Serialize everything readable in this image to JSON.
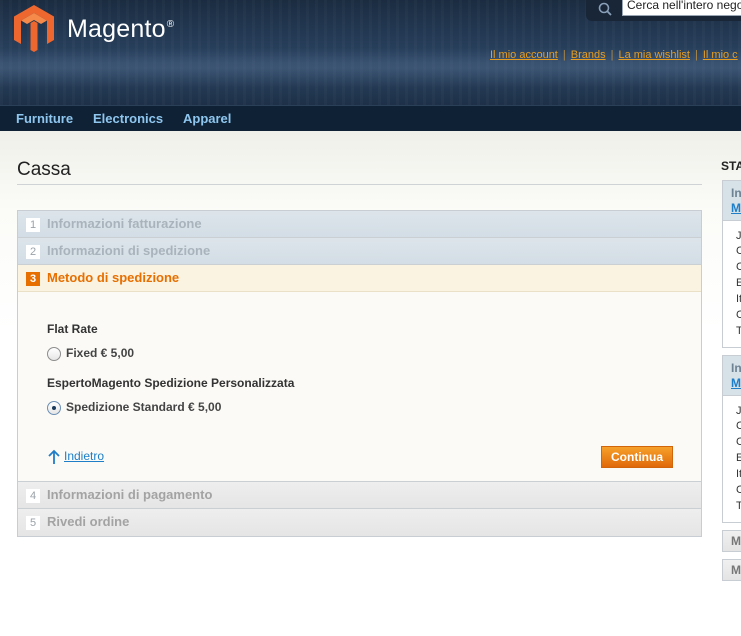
{
  "header": {
    "brand": "Magento",
    "brand_mark": "®",
    "search": {
      "value": "Cerca nell'intero negozio"
    },
    "top_links": [
      "Il mio account",
      "Brands",
      "La mia wishlist",
      "Il mio c"
    ]
  },
  "nav": {
    "items": [
      "Furniture",
      "Electronics",
      "Apparel"
    ]
  },
  "page": {
    "title": "Cassa"
  },
  "checkout": {
    "steps": [
      {
        "num": "1",
        "label": "Informazioni fatturazione"
      },
      {
        "num": "2",
        "label": "Informazioni di spedizione"
      },
      {
        "num": "3",
        "label": "Metodo di spedizione"
      },
      {
        "num": "4",
        "label": "Informazioni di pagamento"
      },
      {
        "num": "5",
        "label": "Rivedi ordine"
      }
    ],
    "shipping": {
      "methods": [
        {
          "title": "Flat Rate",
          "rate": "Fixed € 5,00",
          "checked": false
        },
        {
          "title": "EspertoMagento Spedizione Personalizzata",
          "rate": "Spedizione Standard € 5,00",
          "checked": true
        }
      ],
      "back_label": "Indietro",
      "continue_label": "Continua"
    }
  },
  "sidebar": {
    "title": "STA",
    "boxes": [
      {
        "head1": "In",
        "head2": "M",
        "lines": [
          "J",
          "C",
          "C",
          "E",
          "It",
          "C",
          "T"
        ]
      },
      {
        "head1": "In",
        "head2": "M",
        "lines": [
          "J",
          "C",
          "C",
          "E",
          "It",
          "C",
          "T"
        ]
      }
    ],
    "minis": [
      "M",
      "M"
    ]
  },
  "colors": {
    "accent": "#e76f00",
    "link": "#1e7ec8",
    "nav_text": "#8fc6ef",
    "top_link": "#e79d1f"
  }
}
